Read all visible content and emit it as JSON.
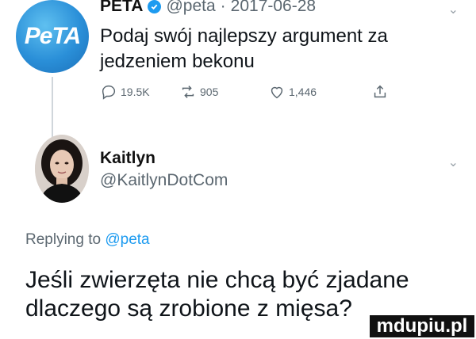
{
  "tweet": {
    "author_name": "PETA",
    "avatar_text": "PeTA",
    "handle": "@peta",
    "separator": "·",
    "date": "2017-06-28",
    "text": "Podaj swój najlepszy argument za jedzeniem bekonu",
    "replies": "19.5K",
    "retweets": "905",
    "likes": "1,446"
  },
  "reply": {
    "author_name": "Kaitlyn",
    "handle": "@KaitlynDotCom",
    "replying_prefix": "Replying to",
    "replying_to": "@peta",
    "text": "Jeśli zwierzęta nie chcą być zjadane dlaczego są zrobione z mięsa?"
  },
  "watermark": "mdupiu.pl",
  "colors": {
    "accent": "#1d9bf0",
    "muted": "#5b6770"
  }
}
